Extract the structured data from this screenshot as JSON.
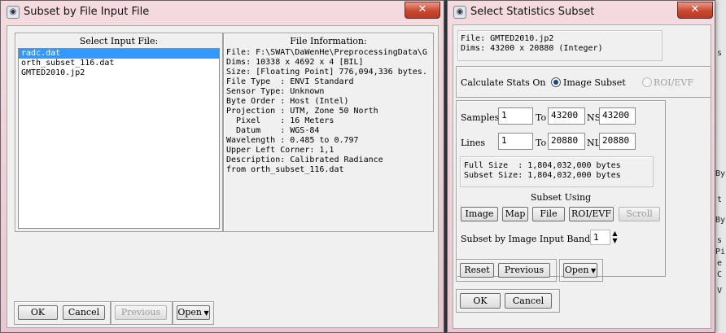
{
  "left_window": {
    "title": "Subset by File Input File",
    "close_symbol": "✕",
    "select_header": "Select Input File:",
    "files": [
      {
        "name": "radc.dat",
        "selected": true
      },
      {
        "name": "orth_subset_116.dat",
        "selected": false
      },
      {
        "name": "GMTED2010.jp2",
        "selected": false
      }
    ],
    "info_header": "File Information:",
    "info_lines": [
      "File: F:\\SWAT\\DaWenHe\\PreprocessingData\\G",
      "Dims: 10338 x 4692 x 4 [BIL]",
      "Size: [Floating Point] 776,094,336 bytes.",
      "File Type  : ENVI Standard",
      "Sensor Type: Unknown",
      "Byte Order : Host (Intel)",
      "Projection : UTM, Zone 50 North",
      "  Pixel    : 16 Meters",
      "  Datum    : WGS-84",
      "Wavelength : 0.485 to 0.797",
      "Upper Left Corner: 1,1",
      "Description: Calibrated Radiance",
      "from orth_subset_116.dat"
    ],
    "buttons": {
      "ok": "OK",
      "cancel": "Cancel",
      "previous": "Previous",
      "open": "Open"
    }
  },
  "right_window": {
    "title": "Select Statistics Subset",
    "close_symbol": "✕",
    "file_info": [
      "File: GMTED2010.jp2",
      "Dims: 43200 x 20880 (Integer)"
    ],
    "calc_label": "Calculate Stats On",
    "options": {
      "image_subset": "Image Subset",
      "roi_evf": "ROI/EVF"
    },
    "samples": {
      "label": "Samples",
      "from": "1",
      "to_label": "To",
      "to": "43200",
      "ns_label": "NS",
      "ns": "43200"
    },
    "lines": {
      "label": "Lines",
      "from": "1",
      "to_label": "To",
      "to": "20880",
      "nl_label": "NL",
      "nl": "20880"
    },
    "size_lines": [
      "Full Size  : 1,804,032,000 bytes",
      "Subset Size: 1,804,032,000 bytes"
    ],
    "subset_using_label": "Subset Using",
    "subset_buttons": {
      "image": "Image",
      "map": "Map",
      "file": "File",
      "roi_evf": "ROI/EVF",
      "scroll": "Scroll"
    },
    "band_label": "Subset by Image Input Band",
    "band_value": "1",
    "buttons": {
      "reset": "Reset",
      "previous": "Previous",
      "open": "Open",
      "ok": "OK",
      "cancel": "Cancel"
    }
  },
  "background_fragments": [
    "s",
    "By",
    "t",
    "By",
    "s",
    "Pi",
    "e",
    "C",
    "V"
  ]
}
